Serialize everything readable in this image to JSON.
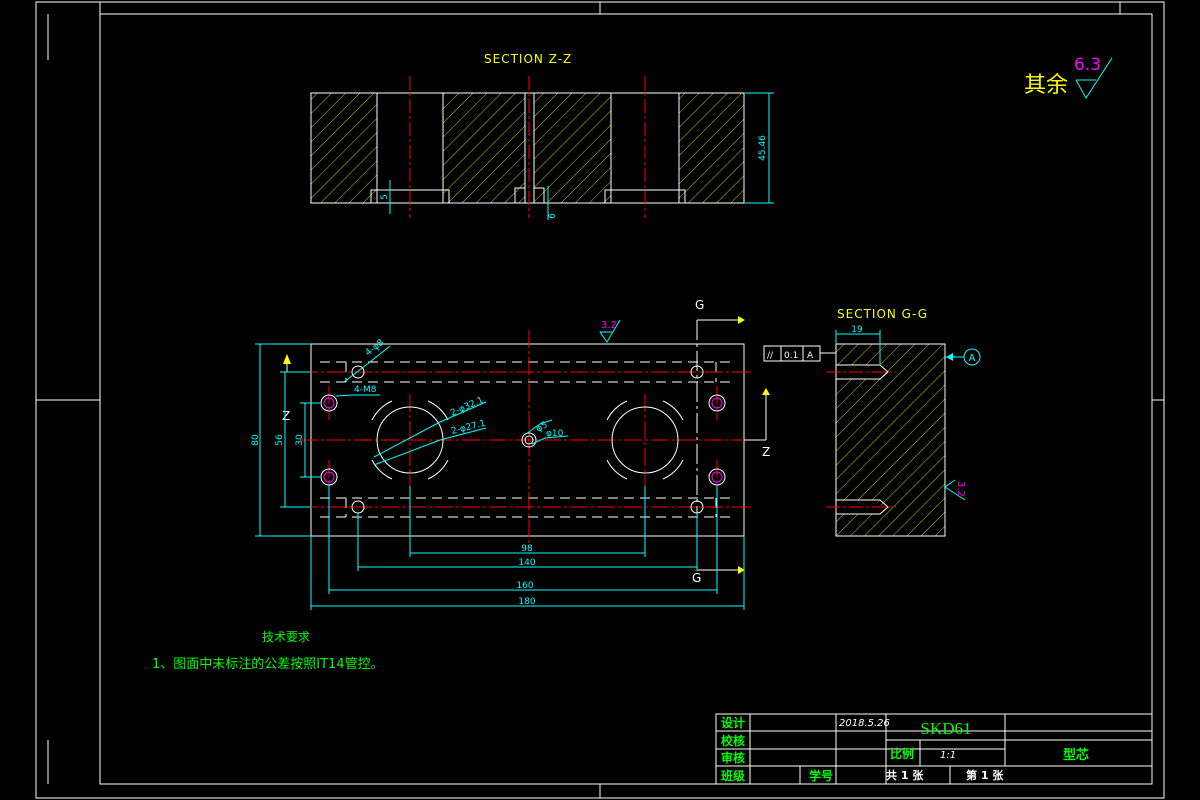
{
  "colors": {
    "background": "#000000",
    "outline": "#ffffff",
    "hatch": "#ffff00",
    "center": "#ff0000",
    "dimension": "#00ffff",
    "text_green": "#00ff00",
    "text_yellow": "#ffff00",
    "magenta": "#ff00ff"
  },
  "section_zz": {
    "title": "SECTION Z-Z",
    "dims": {
      "height": "45.46",
      "small_a": "5",
      "small_b": "6"
    }
  },
  "roughness": {
    "other_label": "其余",
    "other_value": "6.3",
    "top_value": "3.2",
    "side_value": "3.2"
  },
  "plan_view": {
    "cut_g": "G",
    "cut_g_bottom": "G",
    "cut_z": "Z",
    "cut_z_left": "Z",
    "callouts": {
      "c1": "4-φ8",
      "c2": "4-M8",
      "c3": "2-φ32.1",
      "c4": "2-φ27.1",
      "c5": "φ5",
      "c6": "φ10"
    },
    "dims": {
      "h80": "80",
      "h56": "56",
      "h30": "30",
      "w98": "98",
      "w140": "140",
      "w160": "160",
      "w180": "180"
    }
  },
  "section_gg": {
    "title": "SECTION G-G",
    "dim_top": "19",
    "tolerance": {
      "symbol": "//",
      "value": "0.1",
      "datum": "A"
    },
    "datum_label": "A"
  },
  "notes": {
    "heading": "技术要求",
    "item1": "1、图面中未标注的公差按照IT14管控。"
  },
  "title_block": {
    "labels": {
      "design": "设计",
      "check": "校核",
      "review": "审核",
      "class": "班级",
      "student_no": "学号",
      "scale": "比例",
      "total": "共 1 张",
      "sheet": "第 1 张"
    },
    "date": "2018.5.26",
    "material": "SKD61",
    "scale_value": "1:1",
    "part_name": "型芯"
  }
}
